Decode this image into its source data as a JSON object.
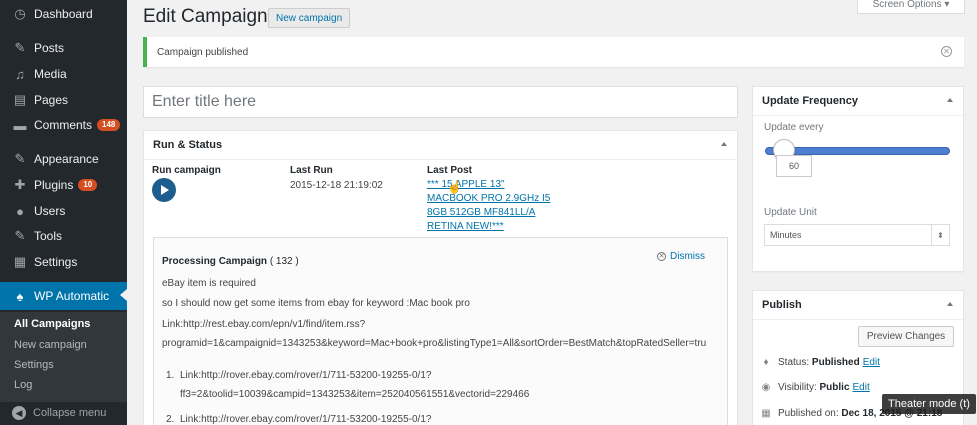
{
  "sidebar": {
    "items": [
      {
        "label": "Dashboard",
        "icon": "dashboard-icon",
        "glyph": "◷"
      },
      {
        "label": "Posts",
        "icon": "pin-icon",
        "glyph": "✎"
      },
      {
        "label": "Media",
        "icon": "media-icon",
        "glyph": "♫"
      },
      {
        "label": "Pages",
        "icon": "pages-icon",
        "glyph": "▤"
      },
      {
        "label": "Comments",
        "icon": "comments-icon",
        "glyph": "▬",
        "badge": "148"
      },
      {
        "label": "Appearance",
        "icon": "appearance-icon",
        "glyph": "✎"
      },
      {
        "label": "Plugins",
        "icon": "plugins-icon",
        "glyph": "✚",
        "badge": "10"
      },
      {
        "label": "Users",
        "icon": "users-icon",
        "glyph": "●"
      },
      {
        "label": "Tools",
        "icon": "tools-icon",
        "glyph": "✎"
      },
      {
        "label": "Settings",
        "icon": "settings-icon",
        "glyph": "▦"
      },
      {
        "label": "WP Automatic",
        "icon": "wp-automatic-icon",
        "glyph": "♠"
      }
    ],
    "submenu": [
      "All Campaigns",
      "New campaign",
      "Settings",
      "Log"
    ],
    "collapse_label": "Collapse menu"
  },
  "header": {
    "screen_options": "Screen Options ▾",
    "title": "Edit Campaign",
    "new_button": "New campaign"
  },
  "notice": {
    "text": "Campaign published"
  },
  "title_input": {
    "placeholder": "Enter title here",
    "value": ""
  },
  "run_status": {
    "heading": "Run & Status",
    "run_label": "Run campaign",
    "last_run_label": "Last Run",
    "last_run_value": "2015-12-18 21:19:02",
    "last_post_label": "Last Post",
    "last_post_lines": [
      "*** 15 APPLE 13\"",
      "MACBOOK PRO 2.9GHz I5",
      "8GB 512GB MF841LL/A",
      "RETINA NEW!***"
    ]
  },
  "processing": {
    "title": "Processing Campaign",
    "count": "( 132 )",
    "dismiss": "Dismiss",
    "lines": [
      "eBay item is required",
      "so I should now get some items from ebay for keyword :Mac book pro",
      "Link:http://rest.ebay.com/epn/v1/find/item.rss?",
      "programid=1&campaignid=1343253&keyword=Mac+book+pro&listingType1=All&sortOrder=BestMatch&topRatedSeller=tru"
    ],
    "list": [
      {
        "num": "1.",
        "text": "Link:http://rover.ebay.com/rover/1/711-53200-19255-0/1?",
        "cont": "ff3=2&toolid=10039&campid=1343253&item=252040561551&vectorid=229466"
      },
      {
        "num": "2.",
        "text": "Link:http://rover.ebay.com/rover/1/711-53200-19255-0/1?"
      }
    ]
  },
  "update_frequency": {
    "heading": "Update Frequency",
    "update_every_label": "Update every",
    "slider_value": "60",
    "update_unit_label": "Update Unit",
    "unit_selected": "Minutes"
  },
  "publish": {
    "heading": "Publish",
    "preview_button": "Preview Changes",
    "status_label": "Status:",
    "status_value": "Published",
    "visibility_label": "Visibility:",
    "visibility_value": "Public",
    "published_on_label": "Published on:",
    "published_on_value": "Dec 18, 2015 @ 21:18",
    "edit_label": "Edit"
  },
  "overlay": {
    "theater_mode": "Theater mode (t)"
  },
  "colors": {
    "sidebar_bg": "#23282d",
    "accent": "#0073aa",
    "notice_success": "#46b450",
    "badge": "#d54e21",
    "slider": "#4f7fd0"
  }
}
